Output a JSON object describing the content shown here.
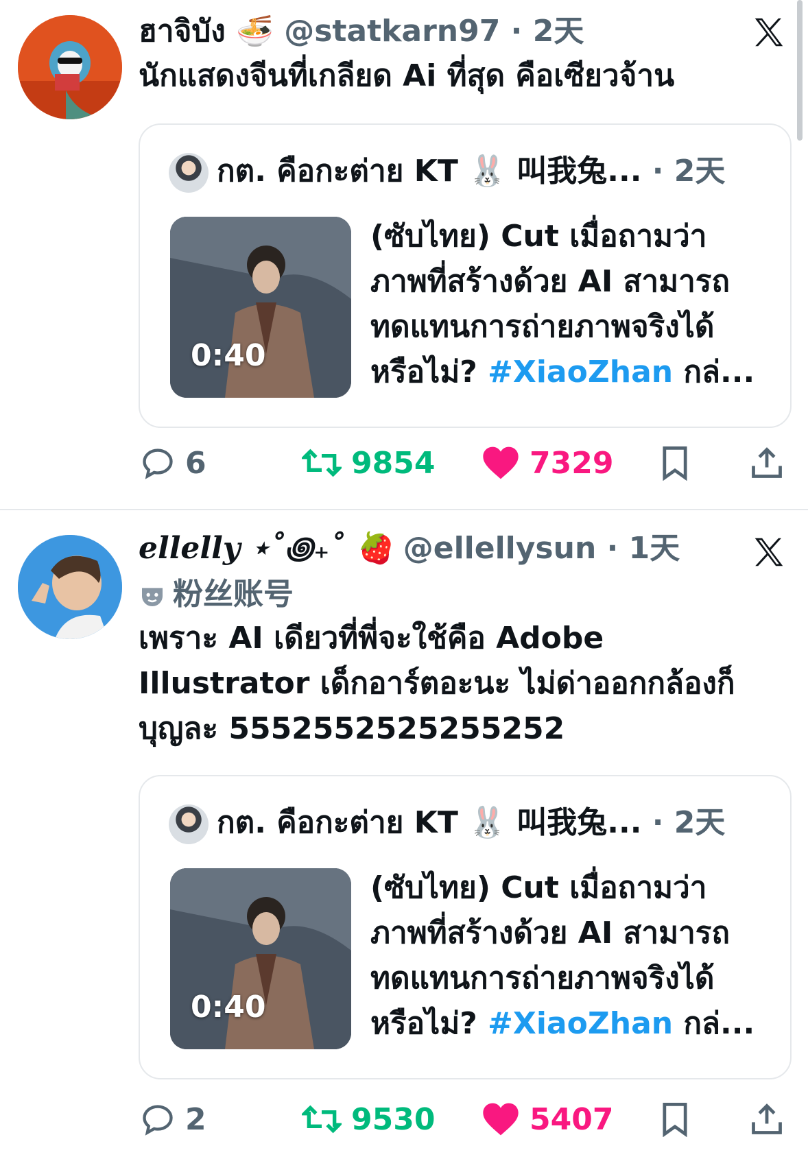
{
  "tweets": [
    {
      "display_name": "ฮาจิบัง 🍜",
      "handle": "@statkarn97",
      "time": "2天",
      "text_lines": [
        "นักแสดงจีนที่เกลียด Ai ที่สุด คือเซียวจ้าน"
      ],
      "quote": {
        "name": "กต. คือกะต่าย KT 🐰 叫我兔...",
        "time": "2天",
        "duration": "0:40",
        "text_lines": [
          "(ซับไทย) Cut เมื่อถามว่า",
          "ภาพที่สร้างด้วย AI สามารถ",
          "ทดแทนการถ่ายภาพจริงได้"
        ],
        "last_line_prefix": "หรือไม่? ",
        "hashtag": "#XiaoZhan",
        "last_line_suffix": " กล่..."
      },
      "replies": "6",
      "retweets": "9854",
      "likes": "7329"
    },
    {
      "display_name": "ellelly ⋆˚꩜₊˚ 🍓",
      "handle": "@ellellysun",
      "time": "1天",
      "badge": "粉丝账号",
      "text_lines": [
        "เพราะ AI เดียวที่พี่จะใช้คือ Adobe",
        "Illustrator เด็กอาร์ตอะนะ ไม่ด่าออกกล้องก็",
        "บุญละ 5552552525255252"
      ],
      "quote": {
        "name": "กต. คือกะต่าย KT 🐰 叫我兔...",
        "time": "2天",
        "duration": "0:40",
        "text_lines": [
          "(ซับไทย) Cut เมื่อถามว่า",
          "ภาพที่สร้างด้วย AI สามารถ",
          "ทดแทนการถ่ายภาพจริงได้"
        ],
        "last_line_prefix": "หรือไม่? ",
        "hashtag": "#XiaoZhan",
        "last_line_suffix": " กล่..."
      },
      "replies": "2",
      "retweets": "9530",
      "likes": "5407"
    }
  ],
  "separator": " · ",
  "colors": {
    "retweet": "#00ba7c",
    "like": "#f91880",
    "hashtag": "#1d9bf0",
    "muted": "#536471"
  },
  "icons": [
    "reply-icon",
    "retweet-icon",
    "heart-icon",
    "bookmark-icon",
    "share-icon",
    "x-logo-icon",
    "fan-mask-icon"
  ]
}
